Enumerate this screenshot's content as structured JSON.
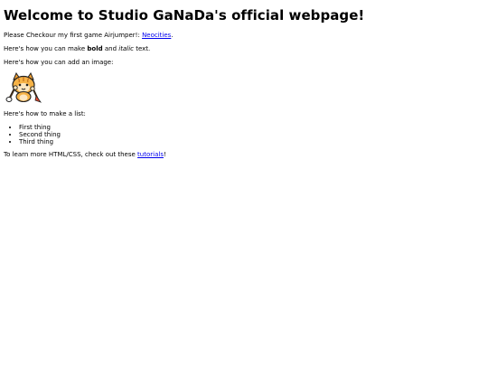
{
  "title": "Welcome to Studio GaNaDa's official webpage!",
  "intro": {
    "prefix": "Please Checkour my first game Airjumper!: ",
    "link": "Neocities",
    "suffix": "."
  },
  "formatting": {
    "prefix": "Here's how you can make ",
    "bold": "bold",
    "middle": " and ",
    "italic": "italic",
    "suffix": " text."
  },
  "image_line": "Here's how you can add an image:",
  "image": {
    "icon": "neocities-cat-mascot-icon"
  },
  "list_heading": "Here's how to make a list:",
  "list_items": [
    "First thing",
    "Second thing",
    "Third thing"
  ],
  "footer": {
    "prefix": "To learn more HTML/CSS, check out these ",
    "link": "tutorials",
    "suffix": "!"
  },
  "colors": {
    "link": "#0000ee",
    "text": "#000000",
    "background": "#ffffff"
  }
}
